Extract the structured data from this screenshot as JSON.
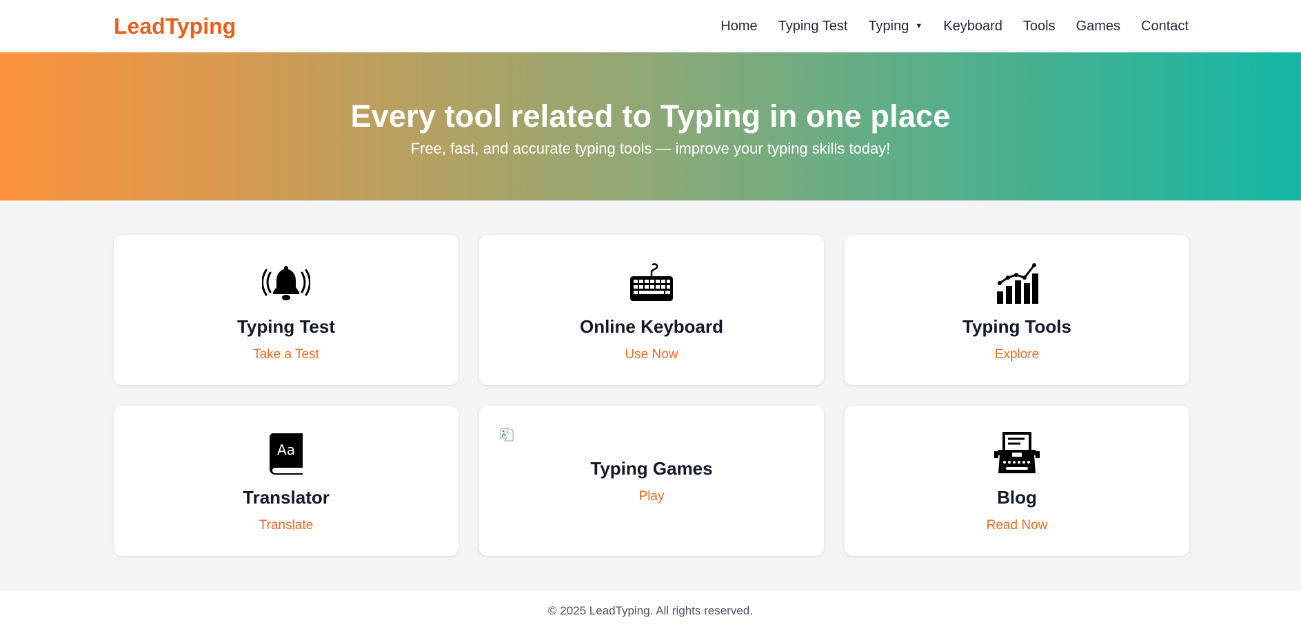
{
  "brand": {
    "name": "LeadTyping",
    "color": "#e8601c"
  },
  "nav": {
    "items": [
      {
        "label": "Home"
      },
      {
        "label": "Typing Test"
      },
      {
        "label": "Typing",
        "has_dropdown": true,
        "caret": "▼"
      },
      {
        "label": "Keyboard"
      },
      {
        "label": "Tools"
      },
      {
        "label": "Games"
      },
      {
        "label": "Contact"
      }
    ]
  },
  "hero": {
    "title": "Every tool related to Typing in one place",
    "subtitle": "Free, fast, and accurate typing tools — improve your typing skills today!",
    "gradient": [
      "#fe923c",
      "#8ea876",
      "#13b7a4"
    ]
  },
  "cards": [
    {
      "icon": "bell-ringing-icon",
      "title": "Typing Test",
      "link": "Take a Test"
    },
    {
      "icon": "keyboard-icon",
      "title": "Online Keyboard",
      "link": "Use Now"
    },
    {
      "icon": "bar-chart-trend-icon",
      "title": "Typing Tools",
      "link": "Explore"
    },
    {
      "icon": "dictionary-book-icon",
      "title": "Translator",
      "link": "Translate"
    },
    {
      "icon": "broken-image-icon",
      "title": "Typing Games",
      "link": "Play"
    },
    {
      "icon": "typewriter-icon",
      "title": "Blog",
      "link": "Read Now"
    }
  ],
  "accent_color": "#ea6a22",
  "footer": {
    "text": "© 2025 LeadTyping. All rights reserved."
  }
}
